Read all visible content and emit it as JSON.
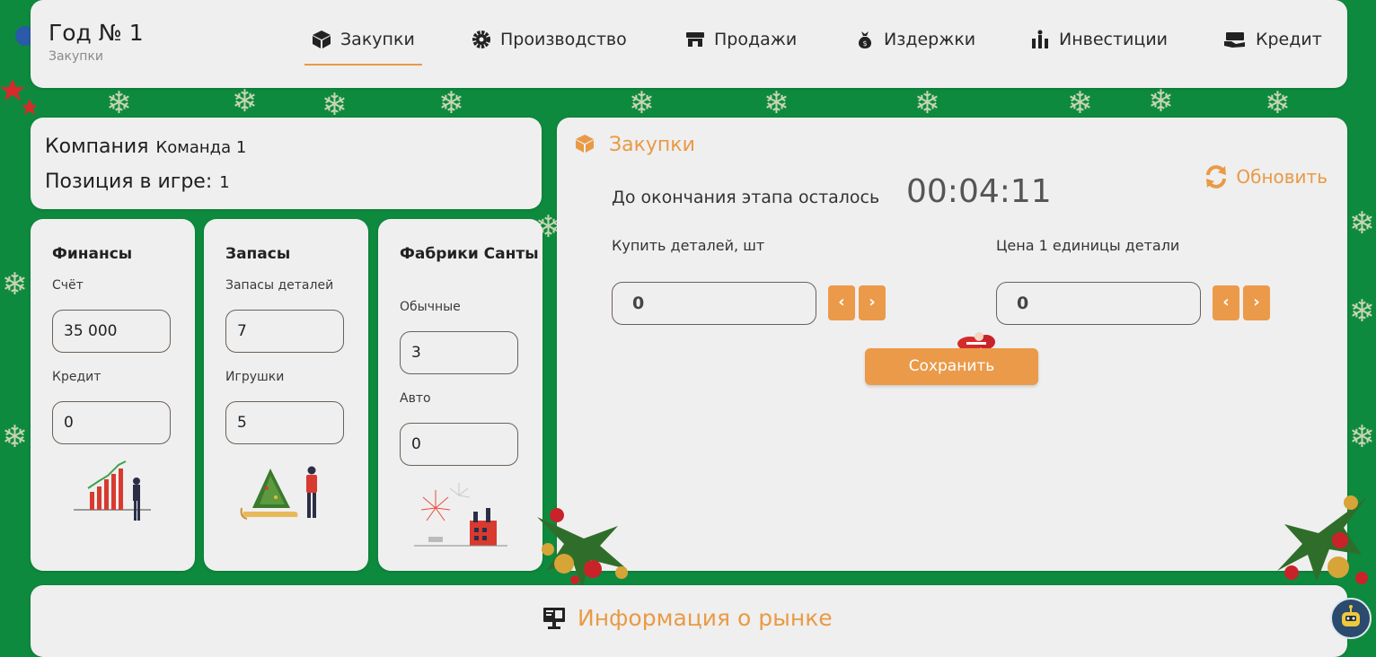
{
  "header": {
    "title": "Год № 1",
    "subtitle": "Закупки",
    "nav": [
      {
        "label": "Закупки",
        "icon": "box-icon",
        "active": true
      },
      {
        "label": "Производство",
        "icon": "gear-icon",
        "active": false
      },
      {
        "label": "Продажи",
        "icon": "store-icon",
        "active": false
      },
      {
        "label": "Издержки",
        "icon": "money-bag-icon",
        "active": false
      },
      {
        "label": "Инвестиции",
        "icon": "investment-icon",
        "active": false
      },
      {
        "label": "Кредит",
        "icon": "credit-icon",
        "active": false
      }
    ]
  },
  "company": {
    "company_label": "Компания",
    "company_value": "Команда 1",
    "position_label": "Позиция в игре:",
    "position_value": "1"
  },
  "finances": {
    "title": "Финансы",
    "account_label": "Счёт",
    "account_value": "35 000",
    "credit_label": "Кредит",
    "credit_value": "0"
  },
  "stocks": {
    "title": "Запасы",
    "parts_label": "Запасы деталей",
    "parts_value": "7",
    "toys_label": "Игрушки",
    "toys_value": "5"
  },
  "factories": {
    "title": "Фабрики Санты",
    "regular_label": "Обычные",
    "regular_value": "3",
    "auto_label": "Авто",
    "auto_value": "0"
  },
  "purchases": {
    "title": "Закупки",
    "refresh_label": "Обновить",
    "timer_label": "До окончания этапа осталось",
    "timer_value": "00:04:11",
    "buy_label": "Купить деталей, шт",
    "buy_value": "0",
    "price_label": "Цена 1 единицы детали",
    "price_value": "0",
    "save_label": "Сохранить"
  },
  "market": {
    "title": "Информация о рынке"
  },
  "colors": {
    "background": "#0e8a3e",
    "card": "#efefef",
    "accent": "#eb9a49"
  }
}
